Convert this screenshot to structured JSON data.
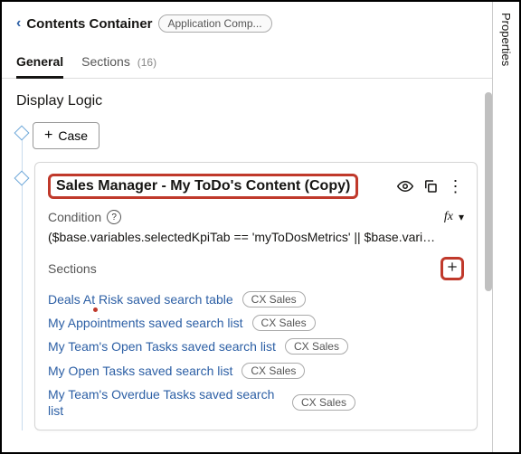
{
  "rightbar": {
    "label": "Properties"
  },
  "header": {
    "page_title": "Contents Container",
    "context_pill": "Application Comp..."
  },
  "tabs": {
    "general": "General",
    "sections": "Sections",
    "sections_count": "(16)"
  },
  "display_logic": {
    "title": "Display Logic"
  },
  "case_button": {
    "label": "Case"
  },
  "card": {
    "title": "Sales Manager - My ToDo's Content (Copy)",
    "condition_label": "Condition",
    "fx_label": "fx",
    "condition_expr": "($base.variables.selectedKpiTab == 'myToDosMetrics' || $base.vari…",
    "sections_label": "Sections",
    "sections": [
      {
        "label": "Deals At Risk saved search table",
        "badge": "CX Sales"
      },
      {
        "label": "My Appointments saved search list",
        "badge": "CX Sales"
      },
      {
        "label": "My Team's Open Tasks saved search list",
        "badge": "CX Sales"
      },
      {
        "label": "My Open Tasks saved search list",
        "badge": "CX Sales"
      },
      {
        "label": "My Team's Overdue Tasks saved search list",
        "badge": "CX Sales"
      }
    ]
  }
}
